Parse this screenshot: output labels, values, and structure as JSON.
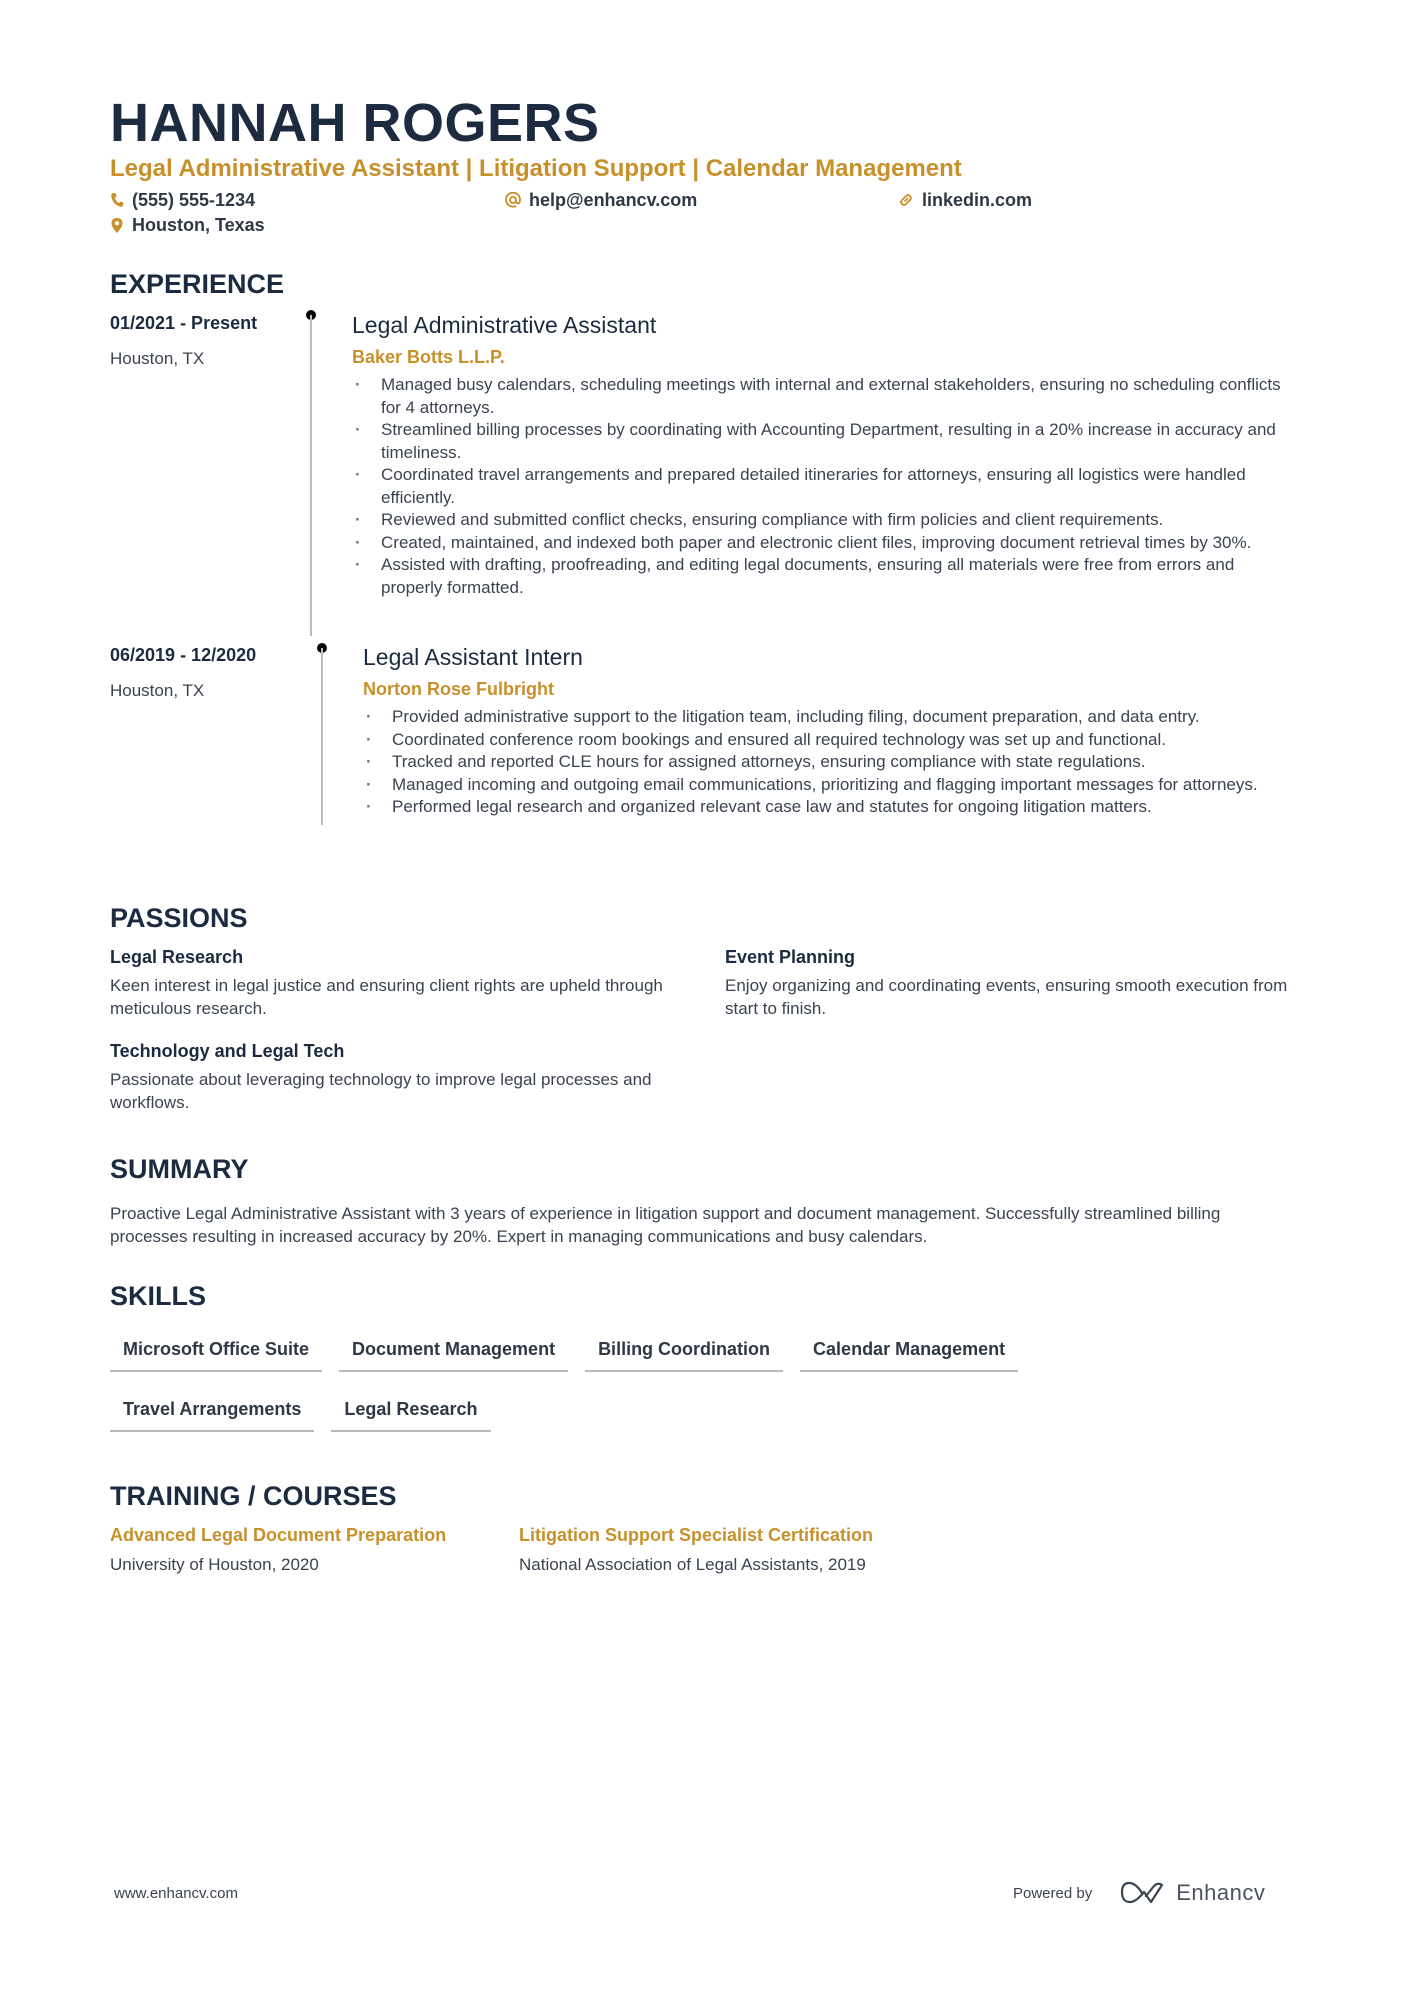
{
  "header": {
    "name": "HANNAH ROGERS",
    "subtitle": "Legal Administrative Assistant | Litigation Support | Calendar Management",
    "contacts": {
      "phone": {
        "icon": "phone-icon",
        "value": "(555) 555-1234"
      },
      "email": {
        "icon": "at-icon",
        "value": "help@enhancv.com"
      },
      "link": {
        "icon": "link-icon",
        "value": "linkedin.com"
      },
      "location": {
        "icon": "map-pin-icon",
        "value": "Houston, Texas"
      }
    }
  },
  "colors": {
    "accent": "#c8902a",
    "heading": "#1c2b40",
    "text": "#3b4350"
  },
  "experience": {
    "title": "EXPERIENCE",
    "jobs": [
      {
        "dates": "01/2021 - Present",
        "location": "Houston, TX",
        "title": "Legal Administrative Assistant",
        "company": "Baker Botts L.L.P.",
        "bullets": [
          "Managed busy calendars, scheduling meetings with internal and external stakeholders, ensuring no scheduling conflicts for 4 attorneys.",
          "Streamlined billing processes by coordinating with Accounting Department, resulting in a 20% increase in accuracy and timeliness.",
          "Coordinated travel arrangements and prepared detailed itineraries for attorneys, ensuring all logistics were handled efficiently.",
          "Reviewed and submitted conflict checks, ensuring compliance with firm policies and client requirements.",
          "Created, maintained, and indexed both paper and electronic client files, improving document retrieval times by 30%.",
          "Assisted with drafting, proofreading, and editing legal documents, ensuring all materials were free from errors and properly formatted."
        ]
      },
      {
        "dates": "06/2019 - 12/2020",
        "location": "Houston, TX",
        "title": "Legal Assistant Intern",
        "company": "Norton Rose Fulbright",
        "bullets": [
          "Provided administrative support to the litigation team, including filing, document preparation, and data entry.",
          "Coordinated conference room bookings and ensured all required technology was set up and functional.",
          "Tracked and reported CLE hours for assigned attorneys, ensuring compliance with state regulations.",
          "Managed incoming and outgoing email communications, prioritizing and flagging important messages for attorneys.",
          "Performed legal research and organized relevant case law and statutes for ongoing litigation matters."
        ]
      }
    ]
  },
  "passions": {
    "title": "PASSIONS",
    "items": [
      {
        "title": "Legal Research",
        "description": "Keen interest in legal justice and ensuring client rights are upheld through meticulous research."
      },
      {
        "title": "Event Planning",
        "description": "Enjoy organizing and coordinating events, ensuring smooth execution from start to finish."
      },
      {
        "title": "Technology and Legal Tech",
        "description": "Passionate about leveraging technology to improve legal processes and workflows."
      }
    ]
  },
  "summary": {
    "title": "SUMMARY",
    "text": "Proactive Legal Administrative Assistant with 3 years of experience in litigation support and document management. Successfully streamlined billing processes resulting in increased accuracy by 20%. Expert in managing communications and busy calendars."
  },
  "skills": {
    "title": "SKILLS",
    "items": [
      "Microsoft Office Suite",
      "Document Management",
      "Billing Coordination",
      "Calendar Management",
      "Travel Arrangements",
      "Legal Research"
    ]
  },
  "training": {
    "title": "TRAINING / COURSES",
    "items": [
      {
        "title": "Advanced Legal Document Preparation",
        "description": "University of Houston, 2020"
      },
      {
        "title": "Litigation Support Specialist Certification",
        "description": "National Association of Legal Assistants, 2019"
      }
    ]
  },
  "footer": {
    "website": "www.enhancv.com",
    "powered_by": "Powered by",
    "brand": "Enhancv"
  }
}
